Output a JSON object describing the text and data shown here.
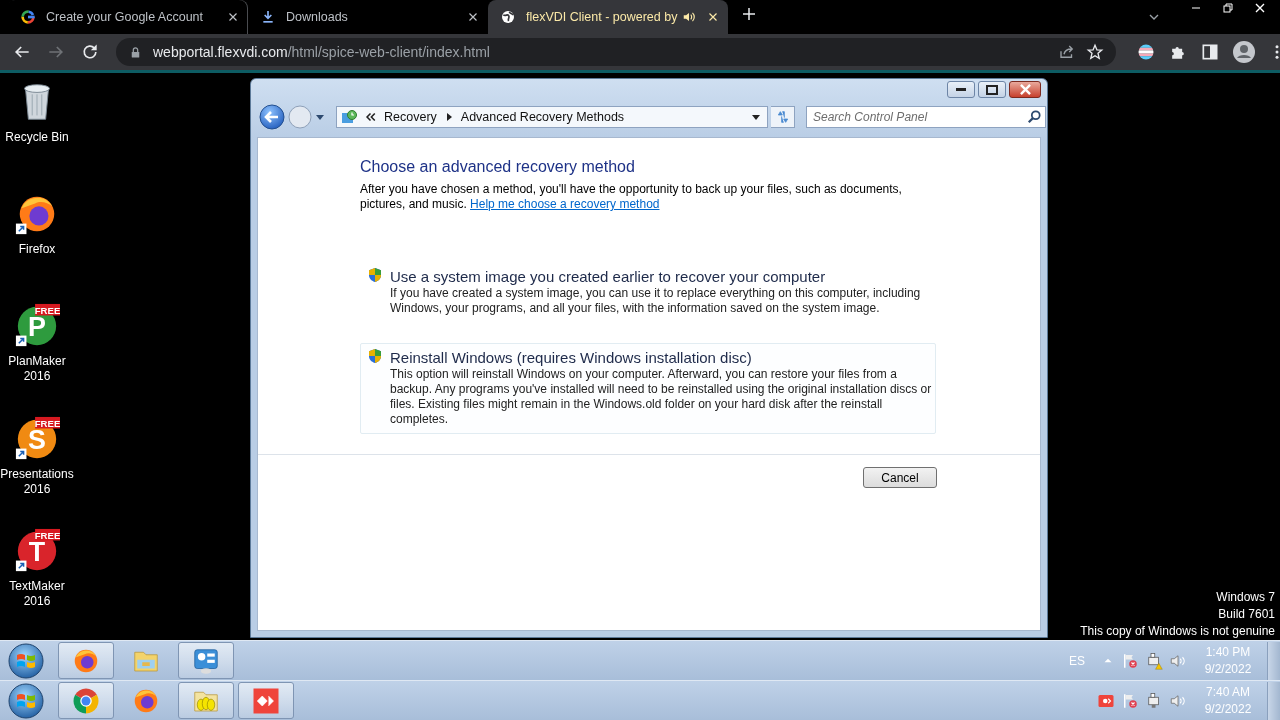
{
  "browser": {
    "tabs": [
      {
        "kind": "google",
        "title": "Create your Google Account",
        "selected": false,
        "audio": false
      },
      {
        "kind": "download",
        "title": "Downloads",
        "selected": false,
        "audio": false
      },
      {
        "kind": "globe",
        "title": "flexVDI Client - powered by",
        "selected": true,
        "audio": true
      }
    ],
    "back": {
      "disabled": false
    },
    "forward": {
      "disabled": true
    },
    "url": {
      "host": "webportal.flexvdi.com",
      "path": "/html/spice-web-client/index.html"
    }
  },
  "desktop": {
    "icons": [
      {
        "kind": "recycle-bin",
        "label": "Recycle Bin"
      },
      {
        "kind": "firefox",
        "label": "Firefox"
      },
      {
        "kind": "letter",
        "letter": "P",
        "ribbon": "FREE",
        "color": "#2e9b3e",
        "label": "PlanMaker 2016"
      },
      {
        "kind": "letter",
        "letter": "S",
        "ribbon": "FREE",
        "color": "#f08a12",
        "label": "Presentations 2016"
      },
      {
        "kind": "letter",
        "letter": "T",
        "ribbon": "FREE",
        "color": "#d9242b",
        "label": "TextMaker 2016"
      }
    ],
    "genuine_notice": [
      "Windows 7",
      "Build 7601",
      "This copy of Windows is not genuine"
    ]
  },
  "window": {
    "breadcrumb": [
      "Recovery",
      "Advanced Recovery Methods"
    ],
    "search": {
      "placeholder": "Search Control Panel"
    },
    "heading": "Choose an advanced recovery method",
    "intro": "After you have chosen a method, you'll have the opportunity to back up your files, such as documents, pictures, and music.",
    "help_link": "Help me choose a recovery method",
    "options": [
      {
        "title": "Use a system image you created earlier to recover your computer",
        "description": "If you have created a system image, you can use it to replace everything on this computer, including Windows, your programs, and all your files, with the information saved on the system image.",
        "highlighted": false
      },
      {
        "title": "Reinstall Windows (requires Windows installation disc)",
        "description": "This option will reinstall Windows on your computer. Afterward, you can restore your files from a backup. Any programs you've installed will need to be reinstalled using the original installation discs or files. Existing files might remain in the Windows.old folder on your hard disk after the reinstall completes.",
        "highlighted": true
      }
    ],
    "cancel_button": "Cancel"
  },
  "remote_taskbar": {
    "items": [
      {
        "kind": "firefox",
        "running": true
      },
      {
        "kind": "explorer",
        "running": false
      },
      {
        "kind": "control-panel",
        "running": true
      }
    ],
    "language": "ES",
    "tray": [
      {
        "kind": "show-hidden"
      },
      {
        "kind": "action-center"
      },
      {
        "kind": "network-warning"
      },
      {
        "kind": "volume"
      }
    ],
    "time": "1:40 PM",
    "date": "9/2/2022"
  },
  "local_taskbar": {
    "items": [
      {
        "kind": "chrome",
        "running": true
      },
      {
        "kind": "firefox",
        "running": false
      },
      {
        "kind": "folder",
        "running": true
      },
      {
        "kind": "anydesk",
        "running": true
      }
    ],
    "tray": [
      {
        "kind": "anydesk"
      },
      {
        "kind": "action-center"
      },
      {
        "kind": "network"
      },
      {
        "kind": "volume"
      }
    ],
    "time": "7:40 AM",
    "date": "9/2/2022"
  }
}
